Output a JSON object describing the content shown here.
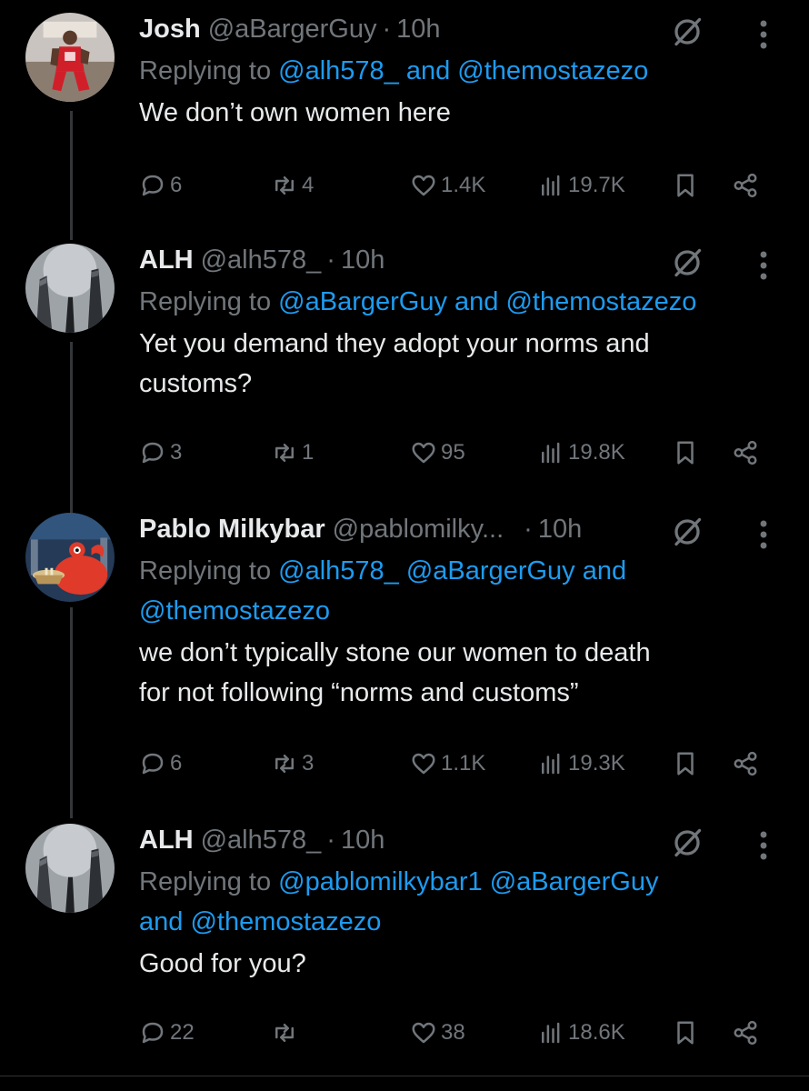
{
  "tweets": [
    {
      "name": "Josh",
      "handle": "@aBargerGuy",
      "dot": "·",
      "time": "10h",
      "replying_prefix": "Replying to",
      "replying_links_line1": "@alh578_ and @themostazezo",
      "replying_links_line2": "",
      "text_lines": [
        "We don’t own women here"
      ],
      "replies": "6",
      "reposts": "4",
      "likes": "1.4K",
      "views": "19.7K"
    },
    {
      "name": "ALH",
      "handle": "@alh578_",
      "dot": "·",
      "time": "10h",
      "replying_prefix": "Replying to",
      "replying_links_line1": "@aBargerGuy and @themostazezo",
      "replying_links_line2": "",
      "text_lines": [
        "Yet you demand they adopt your norms and",
        "customs?"
      ],
      "replies": "3",
      "reposts": "1",
      "likes": "95",
      "views": "19.8K"
    },
    {
      "name": "Pablo Milkybar",
      "handle": "@pablomilky...",
      "dot": "·",
      "time": "10h",
      "replying_prefix": "Replying to",
      "replying_links_line1": "@alh578_ @aBargerGuy and",
      "replying_links_line2": "@themostazezo",
      "text_lines": [
        "we don’t typically stone our women to death",
        "for not following “norms and customs”"
      ],
      "replies": "6",
      "reposts": "3",
      "likes": "1.1K",
      "views": "19.3K"
    },
    {
      "name": "ALH",
      "handle": "@alh578_",
      "dot": "·",
      "time": "10h",
      "replying_prefix": "Replying to",
      "replying_links_line1": "@pablomilkybar1 @aBargerGuy",
      "replying_links_line2": "and @themostazezo",
      "text_lines": [
        "Good for you?"
      ],
      "replies": "22",
      "reposts": "",
      "likes": "38",
      "views": "18.6K"
    }
  ],
  "colors": {
    "background": "#000000",
    "text": "#e7e9ea",
    "muted": "#71767b",
    "link": "#1d9bf0",
    "thread_line": "#333639"
  }
}
